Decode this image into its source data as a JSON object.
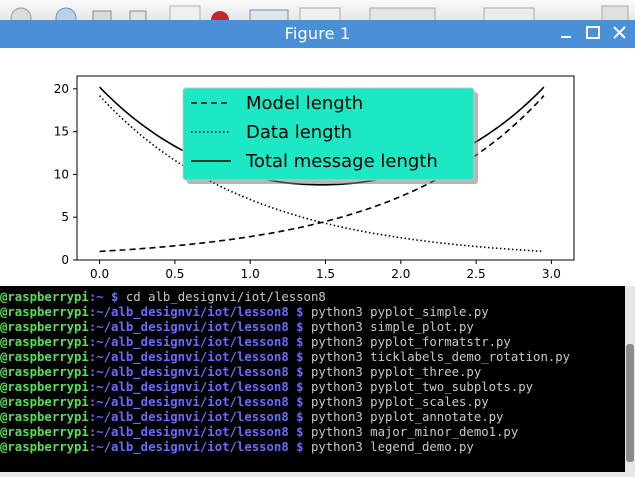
{
  "window": {
    "title": "Figure 1",
    "minimize_icon": "minimize-icon",
    "maximize_icon": "maximize-icon",
    "close_icon": "close-icon",
    "titlebar_color": "#4a90d9"
  },
  "chart_data": {
    "type": "line",
    "x_range": [
      0,
      3
    ],
    "xlim": [
      -0.15,
      3.15
    ],
    "ylim": [
      0,
      21.5
    ],
    "x_ticks": [
      "0.0",
      "0.5",
      "1.0",
      "1.5",
      "2.0",
      "2.5",
      "3.0"
    ],
    "y_ticks": [
      "0",
      "5",
      "10",
      "15",
      "20"
    ],
    "series": [
      {
        "name": "Model length",
        "style": "dashed",
        "color": "#000000",
        "x": [
          0,
          0.5,
          1.0,
          1.5,
          2.0,
          2.5,
          2.95
        ],
        "y": [
          1.0,
          1.6,
          2.7,
          4.5,
          7.4,
          12.2,
          19.2
        ]
      },
      {
        "name": "Data length",
        "style": "dotted",
        "color": "#000000",
        "x": [
          0,
          0.5,
          1.0,
          1.5,
          2.0,
          2.5,
          2.95
        ],
        "y": [
          19.2,
          12.2,
          7.4,
          4.5,
          2.7,
          1.6,
          1.0
        ]
      },
      {
        "name": "Total message length",
        "style": "solid",
        "color": "#000000",
        "x": [
          0,
          0.5,
          1.0,
          1.5,
          2.0,
          2.5,
          2.95
        ],
        "y": [
          20.2,
          13.8,
          10.1,
          9.0,
          10.1,
          13.8,
          20.2
        ]
      }
    ],
    "legend": {
      "placement": "upper center",
      "facecolor": "#1de8c4",
      "shadow": true
    }
  },
  "terminal": {
    "lines": [
      {
        "user": "@raspberrypi",
        "path": ":~ $",
        "cmd": " cd alb_designvi/iot/lesson8"
      },
      {
        "user": "@raspberrypi",
        "path": ":~/alb_designvi/iot/lesson8 $",
        "cmd": " python3 pyplot_simple.py"
      },
      {
        "user": "@raspberrypi",
        "path": ":~/alb_designvi/iot/lesson8 $",
        "cmd": " python3 simple_plot.py"
      },
      {
        "user": "@raspberrypi",
        "path": ":~/alb_designvi/iot/lesson8 $",
        "cmd": " python3 pyplot_formatstr.py"
      },
      {
        "user": "@raspberrypi",
        "path": ":~/alb_designvi/iot/lesson8 $",
        "cmd": " python3 ticklabels_demo_rotation.py"
      },
      {
        "user": "@raspberrypi",
        "path": ":~/alb_designvi/iot/lesson8 $",
        "cmd": " python3 pyplot_three.py"
      },
      {
        "user": "@raspberrypi",
        "path": ":~/alb_designvi/iot/lesson8 $",
        "cmd": " python3 pyplot_two_subplots.py"
      },
      {
        "user": "@raspberrypi",
        "path": ":~/alb_designvi/iot/lesson8 $",
        "cmd": " python3 pyplot_scales.py"
      },
      {
        "user": "@raspberrypi",
        "path": ":~/alb_designvi/iot/lesson8 $",
        "cmd": " python3 pyplot_annotate.py"
      },
      {
        "user": "@raspberrypi",
        "path": ":~/alb_designvi/iot/lesson8 $",
        "cmd": " python3 major_minor_demo1.py"
      },
      {
        "user": "@raspberrypi",
        "path": ":~/alb_designvi/iot/lesson8 $",
        "cmd": " python3 legend_demo.py"
      }
    ]
  }
}
